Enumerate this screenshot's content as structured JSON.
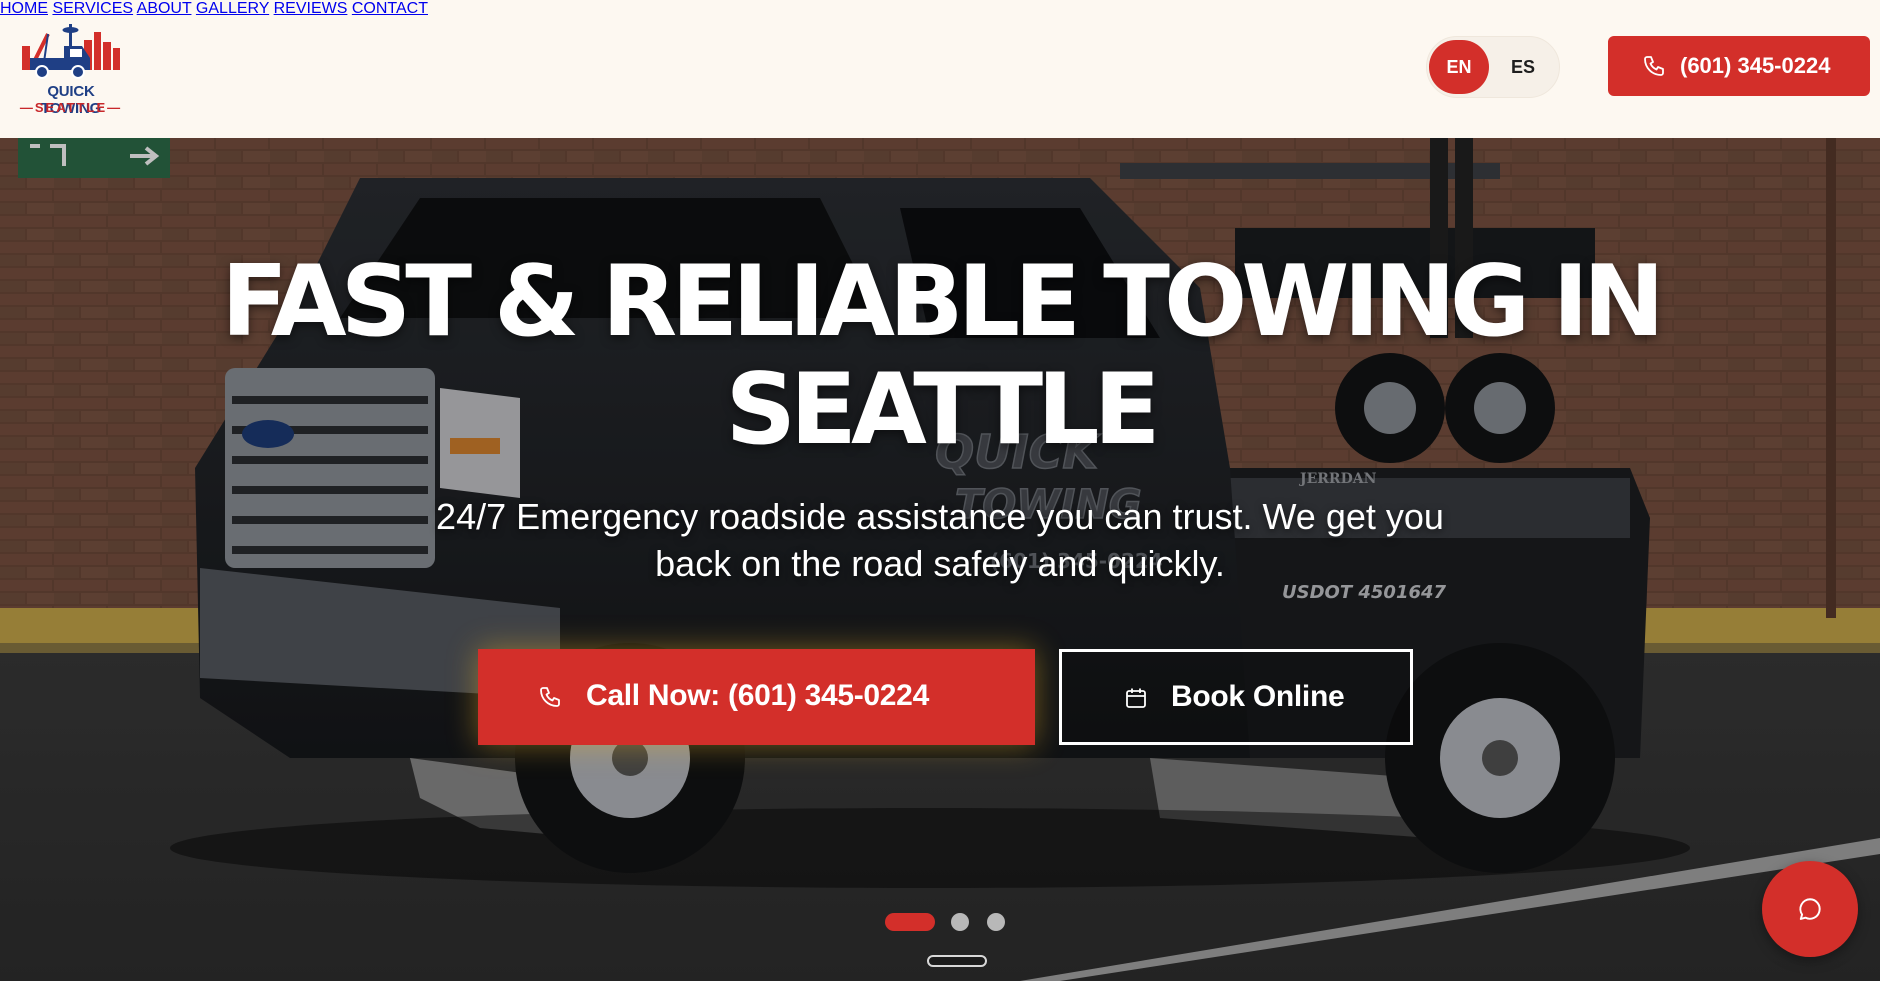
{
  "brand": {
    "logo_line1": "QUICK TOWING",
    "logo_line2": "SEATTLE"
  },
  "nav": {
    "items": [
      {
        "label": "HOME"
      },
      {
        "label": "SERVICES"
      },
      {
        "label": "ABOUT"
      },
      {
        "label": "GALLERY"
      },
      {
        "label": "REVIEWS"
      },
      {
        "label": "CONTACT"
      }
    ]
  },
  "language": {
    "options": [
      "EN",
      "ES"
    ],
    "selected": "EN"
  },
  "header_phone": {
    "label": "(601) 345-0224",
    "icon": "phone-icon"
  },
  "hero": {
    "title_line1": "FAST & RELIABLE TOWING IN",
    "title_line2": "SEATTLE",
    "subtitle_line1": "24/7 Emergency roadside assistance you can trust. We get you",
    "subtitle_line2": "back on the road safely and quickly.",
    "call_button": {
      "label": "Call Now: (601) 345-0224",
      "icon": "phone-icon"
    },
    "book_button": {
      "label": "Book Online",
      "icon": "calendar-icon"
    },
    "background_image_text": {
      "truck_lettering_1": "QUICK",
      "truck_lettering_2": "TOWING",
      "truck_phone": "(601) 345-0224",
      "usdot": "USDOT 4501647",
      "bed_brand": "JERRDAN"
    },
    "carousel": {
      "slide_count": 3,
      "active_index": 0
    }
  },
  "chat": {
    "icon": "chat-bubble-icon"
  },
  "colors": {
    "accent": "#d32f2a",
    "header_bg": "#fdf8f1",
    "logo_blue": "#1f3f85",
    "text_dark": "#1e1e1e"
  }
}
